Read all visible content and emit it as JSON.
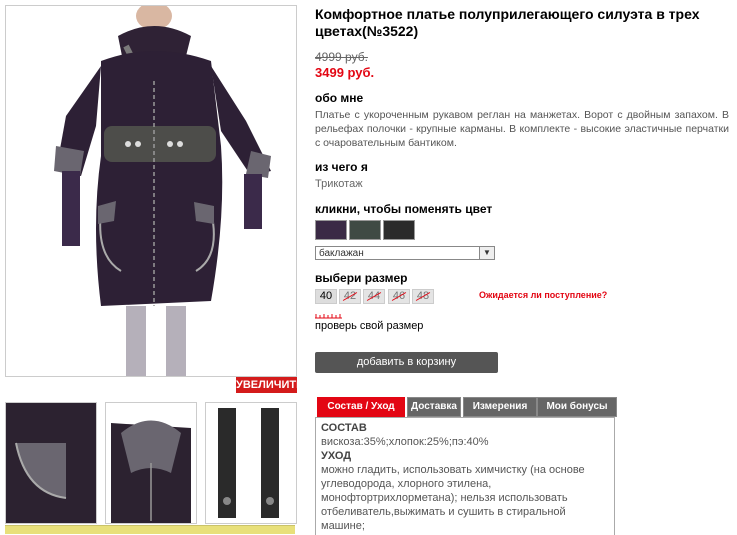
{
  "product": {
    "title": "Комфортное платье полуприлегающего силуэта в трех цветах(№3522)",
    "old_price": "4999 руб.",
    "new_price": "3499 руб."
  },
  "gallery": {
    "zoom_label": "УВЕЛИЧИТЬ"
  },
  "about": {
    "heading": "обо мне",
    "text": "Платье с укороченным рукавом реглан на манжетах. Ворот с двойным запахом. В рельефах полочки - крупные карманы. В комплекте - высокие эластичные перчатки с очаровательным бантиком."
  },
  "made_of": {
    "heading": "из чего я",
    "value": "Трикотаж"
  },
  "color": {
    "heading": "кликни, чтобы поменять цвет",
    "selected": "баклажан",
    "swatches": [
      "#3a2a45",
      "#3f4a44",
      "#2b2b2b"
    ]
  },
  "size": {
    "heading": "выбери размер",
    "options": [
      {
        "label": "40",
        "available": true
      },
      {
        "label": "42",
        "available": false
      },
      {
        "label": "44",
        "available": false
      },
      {
        "label": "46",
        "available": false
      },
      {
        "label": "48",
        "available": false
      }
    ],
    "notify_label": "Ожидается ли поступление?",
    "check_label": "проверь свой размер"
  },
  "cart": {
    "add_label": "добавить в корзину"
  },
  "tabs": {
    "items": [
      "Состав / Уход",
      "Доставка",
      "Измерения",
      "Мои бонусы"
    ],
    "active": 0
  },
  "composition": {
    "heading": "СОСТАВ",
    "value": "вискоза:35%;хлопок:25%;пэ:40%",
    "care_heading": "УХОД",
    "care_text": "можно гладить, использовать химчистку (на основе углеводорода, хлорного этилена, монофтортрихлорметана); нельзя использовать отбеливатель,выжимать и сушить в стиральной машине;"
  },
  "colors": {
    "accent": "#e30613",
    "tab_inactive": "#666666",
    "button": "#555555"
  }
}
